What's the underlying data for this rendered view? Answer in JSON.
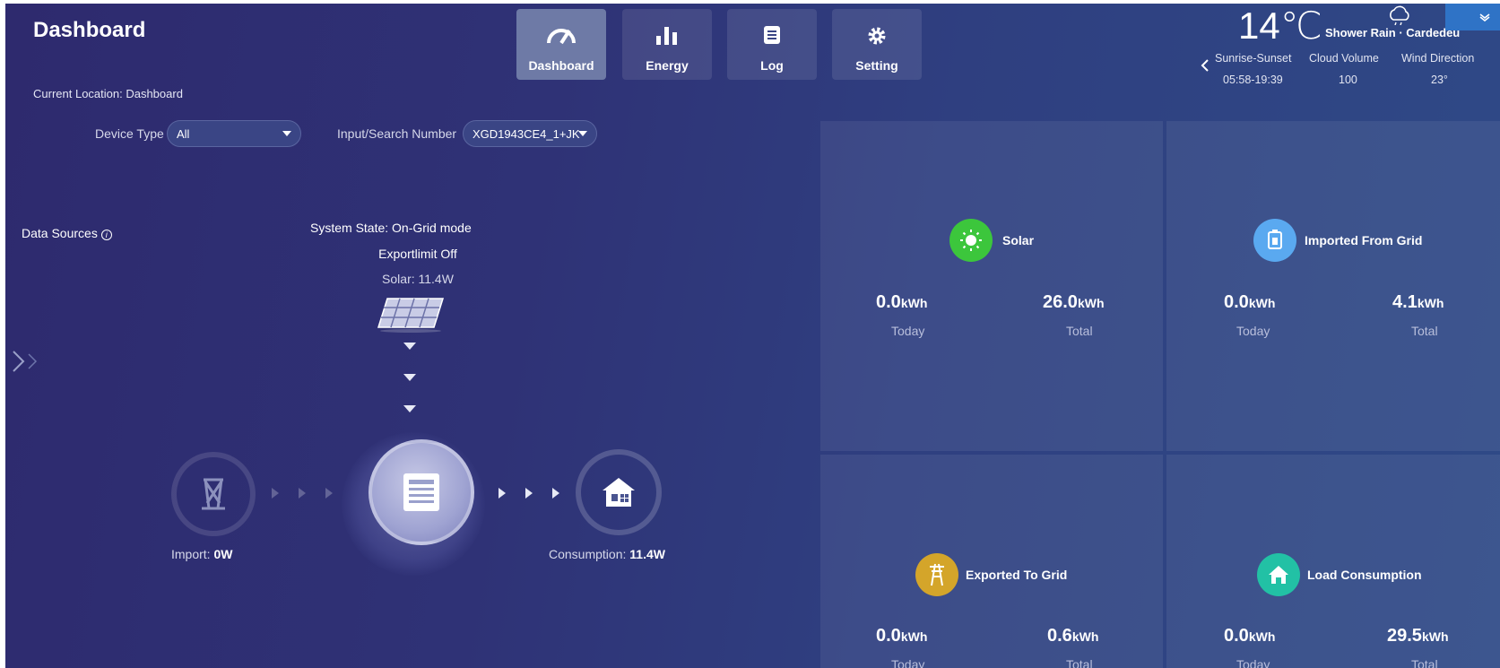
{
  "header": {
    "title": "Dashboard",
    "location": "Current Location: Dashboard"
  },
  "nav": [
    {
      "label": "Dashboard",
      "icon": "gauge-icon",
      "active": true
    },
    {
      "label": "Energy",
      "icon": "bar-chart-icon",
      "active": false
    },
    {
      "label": "Log",
      "icon": "log-icon",
      "active": false
    },
    {
      "label": "Setting",
      "icon": "gear-icon",
      "active": false
    }
  ],
  "filters": {
    "device_type_label": "Device Type",
    "device_type_value": "All",
    "search_label": "Input/Search Number",
    "search_value": "XGD1943CE4_1+JK"
  },
  "weather": {
    "temperature": "14℃",
    "description": "Shower Rain · Cardedeu",
    "sunrise_label": "Sunrise-Sunset",
    "sunrise_value": "05:58-19:39",
    "cloud_label": "Cloud Volume",
    "cloud_value": "100",
    "wind_label": "Wind Direction",
    "wind_value": "23°"
  },
  "flow": {
    "data_sources": "Data Sources",
    "system_state": "System State:  On-Grid mode",
    "export_limit": "Exportlimit Off",
    "solar": "Solar:  11.4W",
    "import_label": "Import:",
    "import_value": "0W",
    "consumption_label": "Consumption:",
    "consumption_value": "11.4W"
  },
  "cards": {
    "solar": {
      "title": "Solar",
      "today": "0.0",
      "total": "26.0",
      "unit": "kWh",
      "today_label": "Today",
      "total_label": "Total",
      "color": "#3cc63c"
    },
    "imported": {
      "title": "Imported From Grid",
      "today": "0.0",
      "total": "4.1",
      "unit": "kWh",
      "today_label": "Today",
      "total_label": "Total",
      "color": "#5aa9f0"
    },
    "exported": {
      "title": "Exported To Grid",
      "today": "0.0",
      "total": "0.6",
      "unit": "kWh",
      "today_label": "Today",
      "total_label": "Total",
      "color": "#d4a52a"
    },
    "load": {
      "title": "Load Consumption",
      "today": "0.0",
      "total": "29.5",
      "unit": "kWh",
      "today_label": "Today",
      "total_label": "Total",
      "color": "#22c1a5"
    }
  }
}
